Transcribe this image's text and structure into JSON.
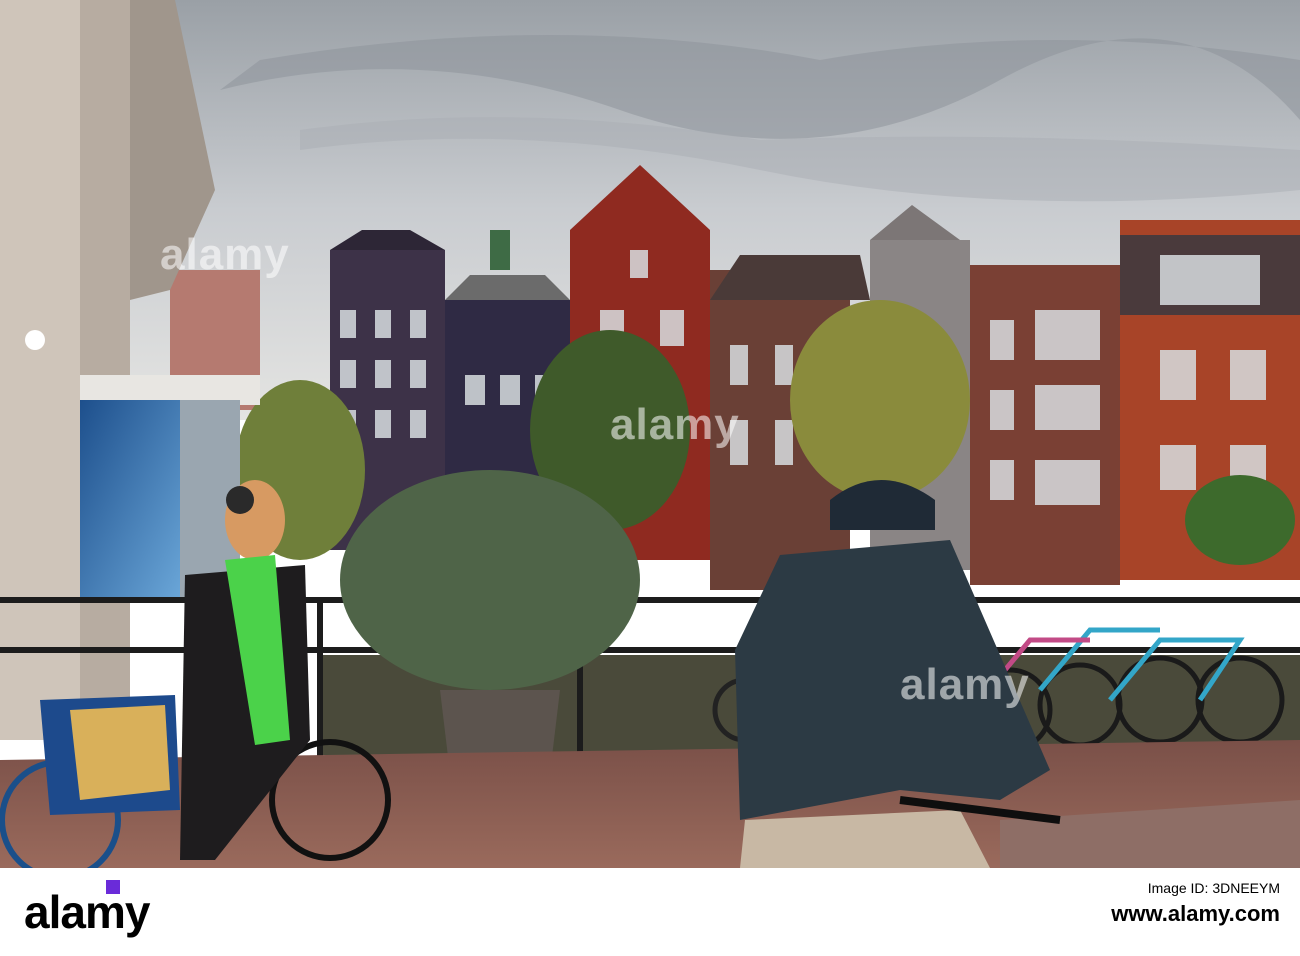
{
  "photo": {
    "subject": "street-scene",
    "palette": {
      "sky": "#c9ccd0",
      "brick_red": "#8f2a20",
      "dark_facade": "#3d3248",
      "tree": "#6f7f3a",
      "pavement": "#8c5a4e",
      "jacket": "#2c3a44",
      "scarf": "#4bd24a",
      "bike_blue": "#33a6c8"
    }
  },
  "watermark": {
    "text": "alamy"
  },
  "footer": {
    "logo_text": "alamy",
    "line1": "Image ID: 3DNEEYM",
    "line2": "www.alamy.com"
  }
}
